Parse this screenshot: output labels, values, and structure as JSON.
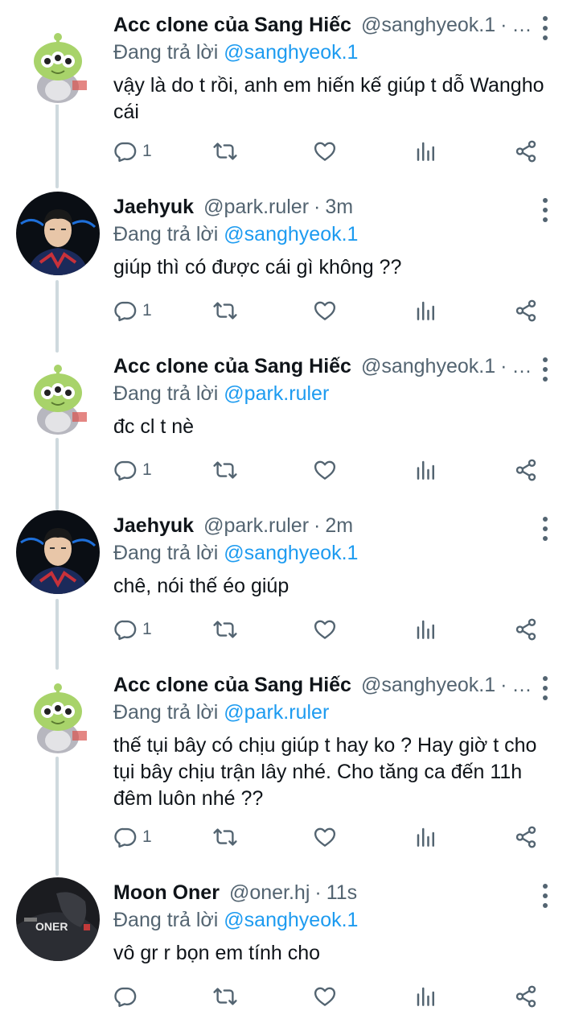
{
  "reply_prefix": "Đang trả lời",
  "colors": {
    "link": "#1d9bf0",
    "muted": "#536471",
    "thread_line": "#cfd9de"
  },
  "tweets": [
    {
      "avatar": "green-alien-plush-avatar",
      "name": "Acc clone của Sang Hiếc",
      "handle": "@sanghyeok.1",
      "time": "…",
      "reply_to": "@sanghyeok.1",
      "lines": [
        "vậy là do t rồi, anh em hiến kế giúp t dỗ Wangho",
        "cái"
      ],
      "reply_count": "1"
    },
    {
      "avatar": "player-portrait-avatar",
      "name": "Jaehyuk",
      "handle": "@park.ruler",
      "time": "3m",
      "reply_to": "@sanghyeok.1",
      "lines": [
        "giúp thì có được cái gì không ??"
      ],
      "reply_count": "1"
    },
    {
      "avatar": "green-alien-plush-avatar",
      "name": "Acc clone của Sang Hiếc",
      "handle": "@sanghyeok.1",
      "time": "…",
      "reply_to": "@park.ruler",
      "lines": [
        "đc cl t nè"
      ],
      "reply_count": "1"
    },
    {
      "avatar": "player-portrait-avatar",
      "name": "Jaehyuk",
      "handle": "@park.ruler",
      "time": "2m",
      "reply_to": "@sanghyeok.1",
      "lines": [
        "chê, nói thế éo giúp"
      ],
      "reply_count": "1"
    },
    {
      "avatar": "green-alien-plush-avatar",
      "name": "Acc clone của Sang Hiếc",
      "handle": "@sanghyeok.1",
      "time": "…",
      "reply_to": "@park.ruler",
      "lines": [
        "thế tụi bây có chịu giúp t hay ko ? Hay giờ t cho",
        "tụi bây chịu trận lây nhé. Cho tăng ca đến 11h",
        "đêm luôn nhé ??"
      ],
      "reply_count": "1"
    },
    {
      "avatar": "oner-jersey-avatar",
      "avatar_text": "ONER",
      "name": "Moon Oner",
      "handle": "@oner.hj",
      "time": "11s",
      "reply_to": "@sanghyeok.1",
      "lines": [
        "vô gr r bọn em tính cho"
      ],
      "reply_count": ""
    }
  ]
}
